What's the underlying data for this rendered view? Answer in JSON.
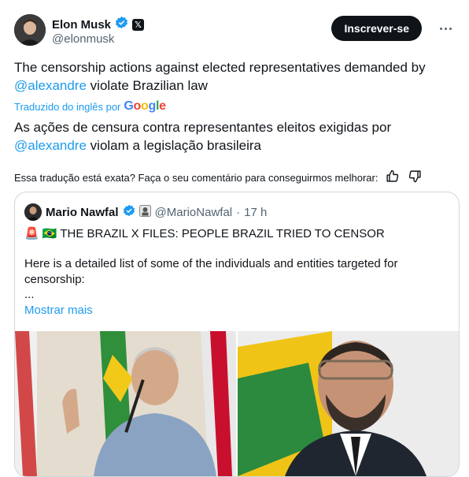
{
  "author": {
    "name": "Elon Musk",
    "handle": "@elonmusk",
    "badge_letter": "𝕏"
  },
  "subscribe_label": "Inscrever-se",
  "tweet": {
    "text_pre": "The censorship actions against elected representatives demanded by",
    "mention": "@alexandre",
    "text_post": " violate Brazilian law"
  },
  "translated_label": "Traduzido do inglês por",
  "google": [
    "G",
    "o",
    "o",
    "g",
    "l",
    "e"
  ],
  "translation": {
    "text_pre": "As ações de censura contra representantes eleitos exigidas por",
    "mention": "@alexandre",
    "text_post": " violam a legislação brasileira"
  },
  "feedback_text": "Essa tradução está exata? Faça o seu comentário para conseguirmos melhorar:",
  "quote": {
    "name": "Mario Nawfal",
    "handle": "@MarioNawfal",
    "dot": "·",
    "time": "17 h",
    "siren": "🚨",
    "flag": "🇧🇷",
    "headline": "THE BRAZIL X FILES:  PEOPLE BRAZIL TRIED TO CENSOR",
    "body": "Here is a detailed list of some of the individuals and entities targeted for censorship:",
    "ellipsis": "...",
    "show_more": "Mostrar mais"
  },
  "colors": {
    "accent": "#1d9bf0",
    "text": "#0f1419",
    "muted": "#536471",
    "border": "#cfd9de"
  }
}
